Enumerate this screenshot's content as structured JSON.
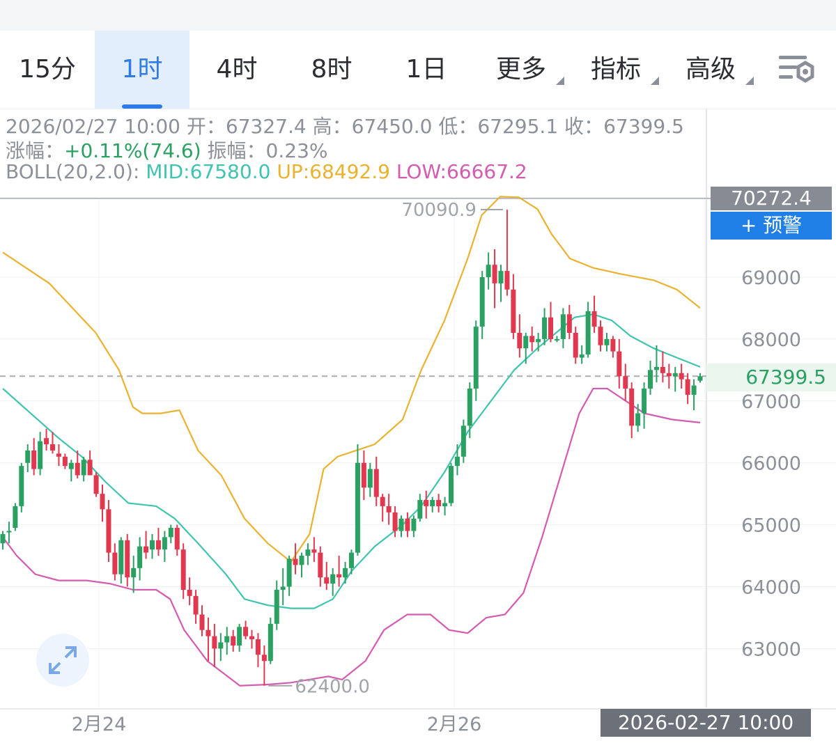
{
  "tabs": [
    {
      "label": "15分",
      "active": false,
      "dropdown": false
    },
    {
      "label": "1时",
      "active": true,
      "dropdown": false
    },
    {
      "label": "4时",
      "active": false,
      "dropdown": false
    },
    {
      "label": "8时",
      "active": false,
      "dropdown": false
    },
    {
      "label": "1日",
      "active": false,
      "dropdown": false
    },
    {
      "label": "更多",
      "active": false,
      "dropdown": true
    },
    {
      "label": "指标",
      "active": false,
      "dropdown": true
    },
    {
      "label": "高级",
      "active": false,
      "dropdown": true
    }
  ],
  "settings_icon": "chart-settings-icon",
  "info": {
    "datetime": "2026/02/27 10:00",
    "open_label": "开：",
    "open": "67327.4",
    "high_label": "高：",
    "high": "67450.0",
    "low_label": "低：",
    "low": "67295.1",
    "close_label": "收：",
    "close": "67399.5",
    "change_label": "涨幅：",
    "change": "+0.11%(74.6)",
    "amplitude_label": "振幅：",
    "amplitude": "0.23%",
    "boll_label": "BOLL(20,2.0):",
    "boll_mid": "MID:67580.0",
    "boll_up": "UP:68492.9",
    "boll_low": "LOW:66667.2"
  },
  "crosshair_price": "70272.4",
  "alert_button": "+ 预警",
  "current_price": "67399.5",
  "crosshair_time": "2026-02-27 10:00",
  "colors": {
    "up": "#2aa162",
    "down": "#e0394f",
    "boll_mid": "#40c4ae",
    "boll_up": "#eab230",
    "boll_low": "#d45cb0",
    "accent": "#2f7be8"
  },
  "chart_data": {
    "type": "candlestick",
    "interval": "1时",
    "y_ticks": [
      63000,
      64000,
      65000,
      66000,
      67000,
      68000,
      69000
    ],
    "ylim": [
      62000,
      70500
    ],
    "x_ticks": [
      "2月24",
      "2月26"
    ],
    "annotations": [
      {
        "label": "70090.9",
        "value": 70090.9,
        "type": "max_high"
      },
      {
        "label": "62400.0",
        "value": 62400.0,
        "type": "min_low"
      }
    ],
    "ohlc": [
      [
        64700,
        64900,
        64600,
        64850
      ],
      [
        64900,
        65050,
        64700,
        64900
      ],
      [
        64950,
        65350,
        64900,
        65300
      ],
      [
        65300,
        66000,
        65200,
        65950
      ],
      [
        66000,
        66300,
        65850,
        66200
      ],
      [
        66200,
        66400,
        65800,
        65900
      ],
      [
        65900,
        66500,
        65800,
        66350
      ],
      [
        66400,
        66550,
        66200,
        66300
      ],
      [
        66300,
        66500,
        66150,
        66200
      ],
      [
        66150,
        66300,
        65950,
        66100
      ],
      [
        66100,
        66150,
        65900,
        65950
      ],
      [
        65900,
        66050,
        65700,
        66000
      ],
      [
        66000,
        66200,
        65750,
        65800
      ],
      [
        65800,
        66100,
        65700,
        66050
      ],
      [
        66050,
        66200,
        65900,
        65800
      ],
      [
        65800,
        65850,
        65450,
        65500
      ],
      [
        65500,
        65650,
        65050,
        65250
      ],
      [
        65250,
        65400,
        64400,
        64550
      ],
      [
        64550,
        64700,
        64100,
        64200
      ],
      [
        64200,
        64800,
        64050,
        64750
      ],
      [
        64750,
        64850,
        64000,
        64150
      ],
      [
        64150,
        64500,
        63900,
        64300
      ],
      [
        64300,
        64800,
        64100,
        64650
      ],
      [
        64650,
        64900,
        64450,
        64550
      ],
      [
        64600,
        64850,
        64450,
        64750
      ],
      [
        64750,
        64950,
        64500,
        64600
      ],
      [
        64600,
        64900,
        64400,
        64800
      ],
      [
        64800,
        65000,
        64700,
        64950
      ],
      [
        64950,
        65000,
        64500,
        64600
      ],
      [
        64600,
        64700,
        63800,
        63950
      ],
      [
        63950,
        64150,
        63700,
        63850
      ],
      [
        63850,
        63950,
        63400,
        63550
      ],
      [
        63550,
        63700,
        63200,
        63300
      ],
      [
        63300,
        63500,
        62800,
        63200
      ],
      [
        63200,
        63400,
        62700,
        63000
      ],
      [
        63000,
        63250,
        62800,
        63100
      ],
      [
        63100,
        63350,
        62900,
        63200
      ],
      [
        63200,
        63300,
        62950,
        63050
      ],
      [
        63050,
        63400,
        62950,
        63350
      ],
      [
        63350,
        63450,
        63150,
        63200
      ],
      [
        63200,
        63300,
        63000,
        63150
      ],
      [
        63150,
        63250,
        62700,
        62900
      ],
      [
        62900,
        63050,
        62400,
        62800
      ],
      [
        62800,
        63500,
        62750,
        63400
      ],
      [
        63400,
        64100,
        63300,
        63950
      ],
      [
        63950,
        64300,
        63700,
        64000
      ],
      [
        64000,
        64500,
        63850,
        64450
      ],
      [
        64450,
        64700,
        64200,
        64350
      ],
      [
        64350,
        64550,
        64150,
        64500
      ],
      [
        64500,
        64700,
        64350,
        64600
      ],
      [
        64600,
        64800,
        64400,
        64550
      ],
      [
        64550,
        64650,
        64000,
        64150
      ],
      [
        64150,
        64400,
        63950,
        64050
      ],
      [
        64050,
        64300,
        63850,
        64200
      ],
      [
        64200,
        64500,
        64000,
        64150
      ],
      [
        64150,
        64400,
        64050,
        64300
      ],
      [
        64300,
        64600,
        64200,
        64550
      ],
      [
        64550,
        66300,
        64500,
        66000
      ],
      [
        66000,
        66200,
        65400,
        65600
      ],
      [
        65600,
        66000,
        65450,
        65900
      ],
      [
        65900,
        66100,
        65300,
        65450
      ],
      [
        65450,
        65500,
        65050,
        65300
      ],
      [
        65300,
        65500,
        65000,
        65200
      ],
      [
        65200,
        65300,
        64800,
        64900
      ],
      [
        64900,
        65150,
        64800,
        65100
      ],
      [
        65100,
        65200,
        64800,
        64900
      ],
      [
        64900,
        65150,
        64800,
        65100
      ],
      [
        65100,
        65500,
        65050,
        65400
      ],
      [
        65400,
        65550,
        65100,
        65300
      ],
      [
        65300,
        65450,
        65200,
        65400
      ],
      [
        65400,
        65500,
        65200,
        65300
      ],
      [
        65300,
        65450,
        65150,
        65350
      ],
      [
        65350,
        66000,
        65300,
        65950
      ],
      [
        65950,
        66300,
        65800,
        66100
      ],
      [
        66100,
        66700,
        66000,
        66600
      ],
      [
        66600,
        67300,
        66400,
        67200
      ],
      [
        67200,
        68300,
        67000,
        68200
      ],
      [
        68200,
        69100,
        68000,
        69000
      ],
      [
        69000,
        69400,
        68800,
        69200
      ],
      [
        69200,
        69450,
        68500,
        68900
      ],
      [
        68900,
        69200,
        68600,
        69100
      ],
      [
        69100,
        70090,
        68700,
        68800
      ],
      [
        68800,
        69050,
        68000,
        68100
      ],
      [
        68100,
        68400,
        67700,
        67850
      ],
      [
        67850,
        68100,
        67600,
        68050
      ],
      [
        68050,
        68200,
        67800,
        67950
      ],
      [
        67950,
        68100,
        67800,
        68000
      ],
      [
        68000,
        68500,
        67900,
        68350
      ],
      [
        68350,
        68600,
        67950,
        68000
      ],
      [
        68000,
        68050,
        67950,
        68000
      ],
      [
        68000,
        68500,
        67850,
        68400
      ],
      [
        68400,
        68550,
        68000,
        68100
      ],
      [
        68100,
        68200,
        67600,
        67700
      ],
      [
        67700,
        67900,
        67600,
        67750
      ],
      [
        67750,
        68600,
        67700,
        68450
      ],
      [
        68450,
        68700,
        68100,
        68200
      ],
      [
        68200,
        68300,
        67800,
        67900
      ],
      [
        67900,
        68100,
        67800,
        68000
      ],
      [
        68000,
        68050,
        67700,
        67800
      ],
      [
        67800,
        68000,
        67200,
        67400
      ],
      [
        67400,
        67600,
        67000,
        67200
      ],
      [
        67200,
        67300,
        66400,
        66600
      ],
      [
        66600,
        66950,
        66500,
        66800
      ],
      [
        66800,
        67300,
        66550,
        67200
      ],
      [
        67200,
        67650,
        67100,
        67500
      ],
      [
        67500,
        67900,
        67300,
        67550
      ],
      [
        67550,
        67800,
        67300,
        67450
      ],
      [
        67450,
        67600,
        67200,
        67400
      ],
      [
        67400,
        67550,
        67150,
        67450
      ],
      [
        67450,
        67600,
        67200,
        67350
      ],
      [
        67350,
        67450,
        66950,
        67100
      ],
      [
        67100,
        67350,
        66850,
        67250
      ],
      [
        67327.4,
        67450,
        67295.1,
        67399.5
      ]
    ],
    "boll_up": [
      [
        0,
        69400
      ],
      [
        10,
        68900
      ],
      [
        20,
        68100
      ],
      [
        25,
        67500
      ],
      [
        28,
        66900
      ],
      [
        30,
        66800
      ],
      [
        34,
        66800
      ],
      [
        38,
        66850
      ],
      [
        42,
        66200
      ],
      [
        47,
        65800
      ],
      [
        52,
        65100
      ],
      [
        57,
        64700
      ],
      [
        62,
        64400
      ],
      [
        66,
        64850
      ],
      [
        69,
        65900
      ],
      [
        72,
        66100
      ],
      [
        76,
        66200
      ],
      [
        80,
        66300
      ],
      [
        86,
        66700
      ],
      [
        90,
        67500
      ],
      [
        95,
        68300
      ],
      [
        100,
        69300
      ],
      [
        103,
        70000
      ],
      [
        107,
        70300
      ],
      [
        111,
        70290
      ],
      [
        115,
        70100
      ],
      [
        118,
        69700
      ],
      [
        122,
        69300
      ],
      [
        127,
        69150
      ],
      [
        133,
        69050
      ],
      [
        140,
        68950
      ],
      [
        145,
        68800
      ],
      [
        150,
        68500
      ]
    ],
    "boll_mid": [
      [
        0,
        67200
      ],
      [
        6,
        66800
      ],
      [
        12,
        66400
      ],
      [
        17,
        66100
      ],
      [
        22,
        65700
      ],
      [
        27,
        65350
      ],
      [
        33,
        65300
      ],
      [
        37,
        65100
      ],
      [
        42,
        64700
      ],
      [
        48,
        64200
      ],
      [
        52,
        63800
      ],
      [
        57,
        63700
      ],
      [
        62,
        63650
      ],
      [
        67,
        63650
      ],
      [
        71,
        63800
      ],
      [
        75,
        64250
      ],
      [
        80,
        64650
      ],
      [
        86,
        65000
      ],
      [
        90,
        65300
      ],
      [
        95,
        65850
      ],
      [
        100,
        66500
      ],
      [
        105,
        67000
      ],
      [
        110,
        67500
      ],
      [
        115,
        67850
      ],
      [
        119,
        68100
      ],
      [
        123,
        68350
      ],
      [
        127,
        68400
      ],
      [
        131,
        68300
      ],
      [
        135,
        68050
      ],
      [
        140,
        67850
      ],
      [
        145,
        67700
      ],
      [
        150,
        67550
      ]
    ],
    "boll_low": [
      [
        0,
        64800
      ],
      [
        3,
        64500
      ],
      [
        7,
        64200
      ],
      [
        12,
        64100
      ],
      [
        18,
        64100
      ],
      [
        23,
        64050
      ],
      [
        28,
        63950
      ],
      [
        33,
        63950
      ],
      [
        36,
        63800
      ],
      [
        39,
        63300
      ],
      [
        44,
        62800
      ],
      [
        51,
        62400
      ],
      [
        57,
        62420
      ],
      [
        62,
        62450
      ],
      [
        70,
        62550
      ],
      [
        73,
        62500
      ],
      [
        78,
        62800
      ],
      [
        82,
        63300
      ],
      [
        87,
        63550
      ],
      [
        92,
        63550
      ],
      [
        96,
        63300
      ],
      [
        100,
        63250
      ],
      [
        104,
        63500
      ],
      [
        108,
        63550
      ],
      [
        112,
        63900
      ],
      [
        116,
        64800
      ],
      [
        120,
        65800
      ],
      [
        124,
        66800
      ],
      [
        127,
        67200
      ],
      [
        130,
        67200
      ],
      [
        134,
        67000
      ],
      [
        138,
        66800
      ],
      [
        144,
        66700
      ],
      [
        150,
        66650
      ]
    ]
  }
}
